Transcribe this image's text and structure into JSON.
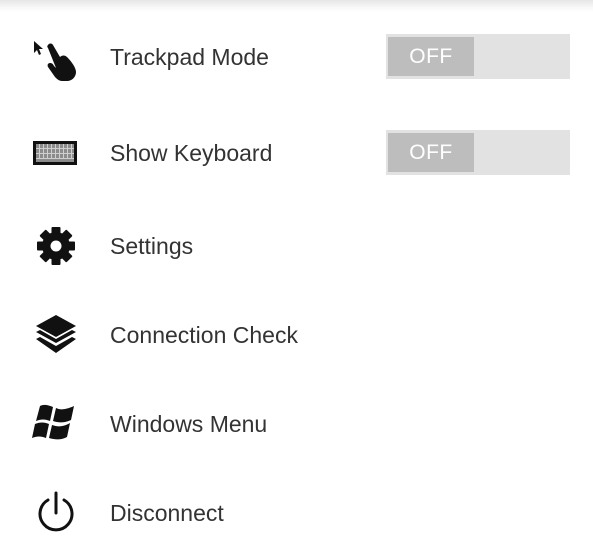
{
  "menu": {
    "items": [
      {
        "label": "Trackpad Mode",
        "icon": "trackpad-pointer-icon",
        "toggle": "OFF"
      },
      {
        "label": "Show Keyboard",
        "icon": "keyboard-icon",
        "toggle": "OFF"
      },
      {
        "label": "Settings",
        "icon": "gear-icon"
      },
      {
        "label": "Connection Check",
        "icon": "layers-icon"
      },
      {
        "label": "Windows Menu",
        "icon": "windows-logo-icon"
      },
      {
        "label": "Disconnect",
        "icon": "power-icon"
      }
    ]
  },
  "colors": {
    "text": "#333333",
    "icon": "#111111",
    "toggle_track": "#e2e2e2",
    "toggle_thumb": "#bdbdbd"
  }
}
